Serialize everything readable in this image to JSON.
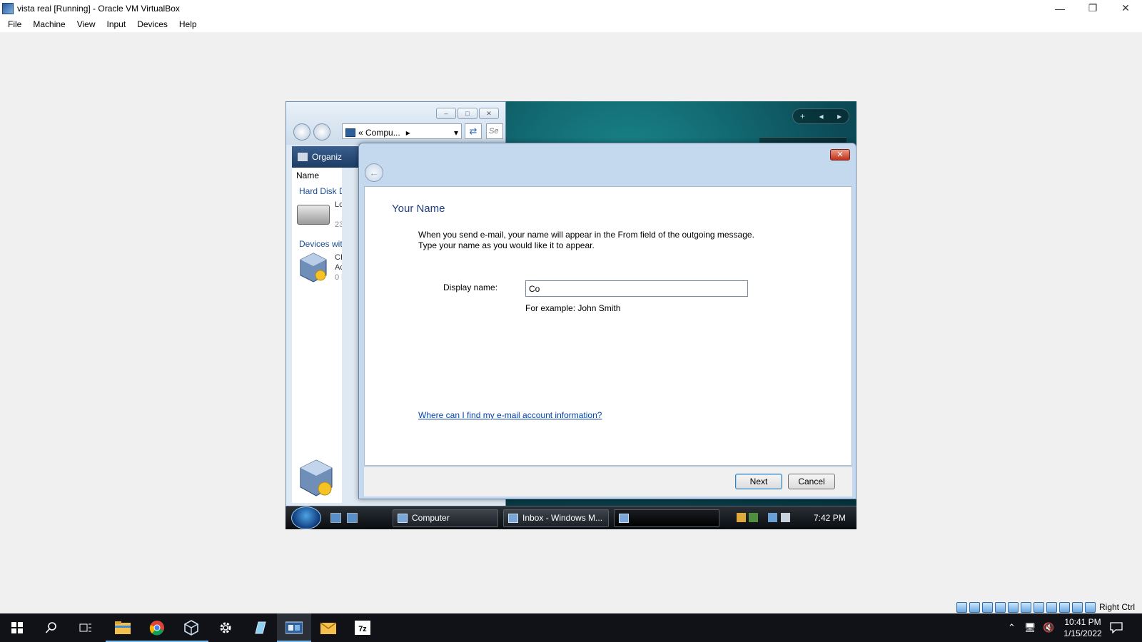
{
  "host": {
    "title": "vista real [Running] - Oracle VM VirtualBox",
    "menu": [
      "File",
      "Machine",
      "View",
      "Input",
      "Devices",
      "Help"
    ],
    "status_key": "Right Ctrl"
  },
  "explorer": {
    "address": "« Compu...",
    "search_stub": "Se",
    "organize": "Organiz",
    "column_name": "Name",
    "group_hdd": "Hard Disk D",
    "group_devices": "Devices wit",
    "drive_label_1": "Lo",
    "drive_label_2": "23",
    "cd_label_1": "CI",
    "cd_label_2": "Ac",
    "cd_label_3": "0 l"
  },
  "dialog": {
    "heading": "Your Name",
    "desc_line1": "When you send e-mail, your name will appear in the From field of the outgoing message.",
    "desc_line2": "Type your name as you would like it to appear.",
    "display_label": "Display name:",
    "display_value": "Co",
    "example": "For example: John Smith",
    "help_link": "Where can I find my e-mail account information?",
    "next": "Next",
    "cancel": "Cancel",
    "close_glyph": "✕",
    "back_glyph": "←"
  },
  "vm_taskbar": {
    "tasks": [
      "Computer",
      "Inbox - Windows M...",
      ""
    ],
    "clock": "7:42 PM"
  },
  "host_taskbar": {
    "time": "10:41 PM",
    "date": "1/15/2022"
  }
}
